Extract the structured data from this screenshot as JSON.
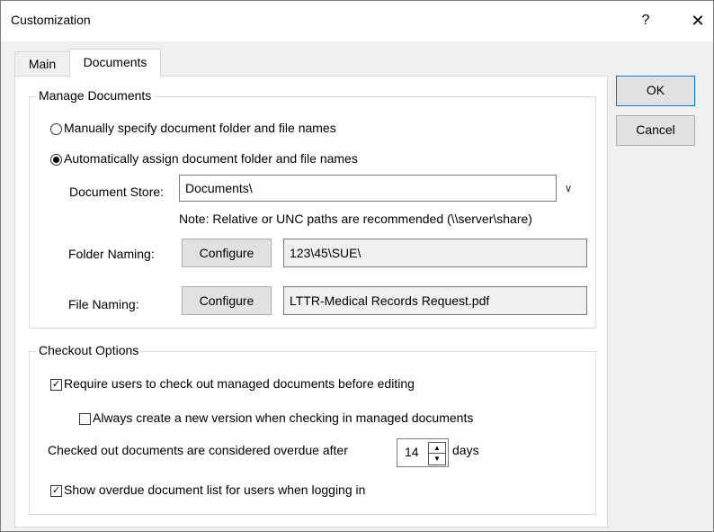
{
  "window": {
    "title": "Customization",
    "help_label": "?",
    "close_label": "✕"
  },
  "tabs": [
    {
      "label": "Main"
    },
    {
      "label": "Documents"
    }
  ],
  "manage_documents": {
    "group_label": "Manage Documents",
    "radio_manual_label": "Manually specify document folder and file names",
    "radio_manual_checked": false,
    "radio_auto_label": "Automatically assign document folder and file names",
    "radio_auto_checked": true,
    "document_store_label": "Document Store:",
    "document_store_value": "Documents\\",
    "note": "Note:  Relative or UNC paths are recommended (\\\\server\\share)",
    "folder_naming_label": "Folder Naming:",
    "folder_configure_label": "Configure",
    "folder_naming_value": "123\\45\\SUE\\",
    "file_naming_label": "File Naming:",
    "file_configure_label": "Configure",
    "file_naming_value": "LTTR-Medical Records Request.pdf"
  },
  "checkout_options": {
    "group_label": "Checkout Options",
    "require_checkout_label": "Require users to check out managed documents before editing",
    "require_checkout_checked": true,
    "new_version_label": "Always create a new version when checking in managed documents",
    "new_version_checked": false,
    "overdue_prefix": "Checked out documents are considered overdue after",
    "overdue_days_value": "14",
    "overdue_suffix": "days",
    "show_overdue_label": "Show overdue document list for users when logging in",
    "show_overdue_checked": true
  },
  "buttons": {
    "ok_label": "OK",
    "cancel_label": "Cancel"
  }
}
